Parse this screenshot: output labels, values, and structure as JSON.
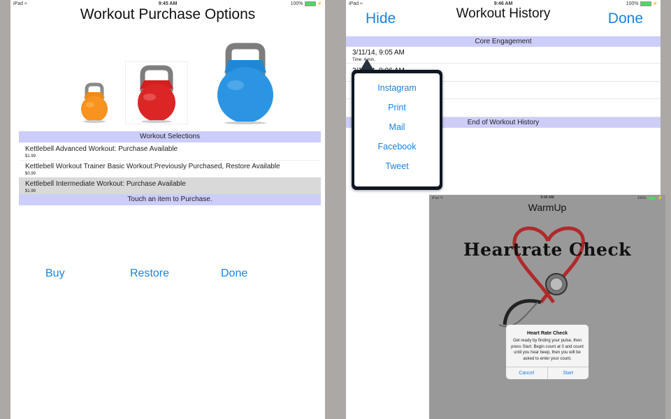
{
  "screen1": {
    "status": {
      "device": "iPad",
      "time": "9:45 AM",
      "battery": "100%"
    },
    "title": "Workout Purchase Options",
    "images": [
      "orange-kettlebell",
      "red-kettlebell",
      "blue-kettlebell"
    ],
    "section_header": "Workout Selections",
    "items": [
      {
        "title": "Kettlebell Advanced Workout:  Purchase Available",
        "price": "$1.99",
        "selected": false
      },
      {
        "title": "Kettlebell Workout Trainer Basic Workout:Previously Purchased, Restore Available",
        "price": "$0.99",
        "selected": false
      },
      {
        "title": "Kettlebell Intermediate Workout:  Purchase Available",
        "price": "$1.99",
        "selected": true
      }
    ],
    "footer": "Touch an item to Purchase.",
    "buttons": {
      "buy": "Buy",
      "restore": "Restore",
      "done": "Done"
    }
  },
  "screen2": {
    "status": {
      "device": "iPad",
      "time": "9:46 AM",
      "battery": "100%"
    },
    "title": "Workout History",
    "hide_label": "Hide",
    "done_label": "Done",
    "section_header": "Core Engagement",
    "rows": [
      {
        "date": "3/11/14, 9:05 AM",
        "detail": "Time: 4 min."
      },
      {
        "date": "3/11/14, 9:06 AM",
        "detail": ""
      },
      {
        "date": "",
        "detail": ""
      },
      {
        "date": "",
        "detail": ""
      }
    ],
    "footer_header": "End of Workout History",
    "share_menu": [
      "Instagram",
      "Print",
      "Mail",
      "Facebook",
      "Tweet"
    ]
  },
  "screen3": {
    "status": {
      "device": "iPad",
      "time": "9:45 AM",
      "battery": "100%"
    },
    "title": "WarmUp",
    "image_caption": "Heartrate Check",
    "alert": {
      "title": "Heart Rate Check",
      "message": "Get ready by finding your pulse, then press Start.  Begin count at 0 and count until you hear beep, then you will be asked to enter your count.",
      "cancel": "Cancel",
      "start": "Start"
    }
  },
  "colors": {
    "accent": "#1a82e0",
    "section_bg": "#cccdf9",
    "selected_row": "#d9d9d9",
    "battery": "#4cd964",
    "backdrop": "#aba8a6"
  }
}
